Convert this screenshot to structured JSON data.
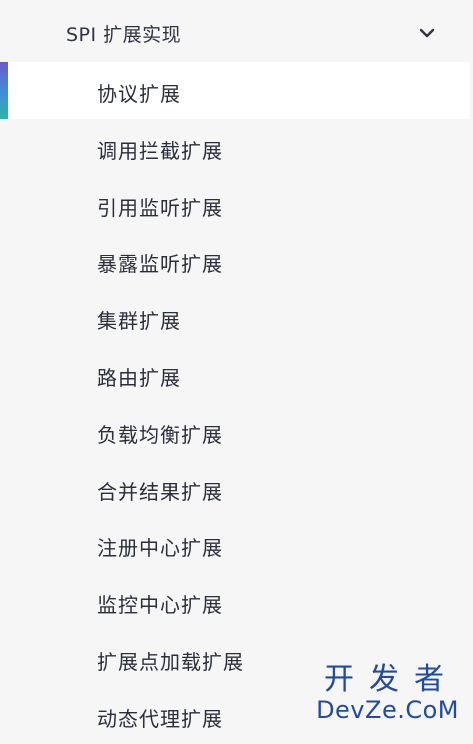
{
  "section": {
    "title": "SPI 扩展实现",
    "expand_icon": "chevron-down-icon"
  },
  "items": [
    {
      "label": "协议扩展",
      "active": true
    },
    {
      "label": "调用拦截扩展",
      "active": false
    },
    {
      "label": "引用监听扩展",
      "active": false
    },
    {
      "label": "暴露监听扩展",
      "active": false
    },
    {
      "label": "集群扩展",
      "active": false
    },
    {
      "label": "路由扩展",
      "active": false
    },
    {
      "label": "负载均衡扩展",
      "active": false
    },
    {
      "label": "合并结果扩展",
      "active": false
    },
    {
      "label": "注册中心扩展",
      "active": false
    },
    {
      "label": "监控中心扩展",
      "active": false
    },
    {
      "label": "扩展点加载扩展",
      "active": false
    },
    {
      "label": "动态代理扩展",
      "active": false
    }
  ],
  "watermark": {
    "line1": "开发者",
    "line2": "DevZe.CoM"
  },
  "colors": {
    "background": "#f6f6f6",
    "active_background": "#ffffff",
    "text": "#2a2f3b",
    "indicator_top": "#6a5acd",
    "indicator_bottom": "#2bb6a3",
    "watermark": "#1f4aa8"
  }
}
